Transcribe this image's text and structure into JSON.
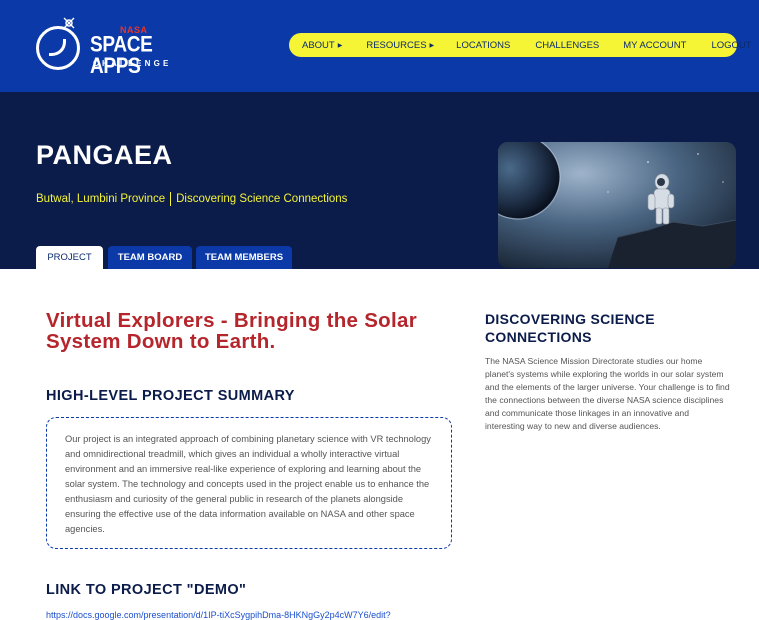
{
  "logo": {
    "nasa": "NASA",
    "title": "SPACE APPS",
    "subtitle": "CHALLENGE"
  },
  "nav": {
    "items": [
      {
        "label": "ABOUT",
        "has_dropdown": true
      },
      {
        "label": "RESOURCES",
        "has_dropdown": true
      },
      {
        "label": "LOCATIONS",
        "has_dropdown": false
      },
      {
        "label": "CHALLENGES",
        "has_dropdown": false
      },
      {
        "label": "MY ACCOUNT",
        "has_dropdown": false
      },
      {
        "label": "LOGOUT",
        "has_dropdown": false
      }
    ],
    "dropdown_icon": "caret-right-icon"
  },
  "hero": {
    "team_name": "PANGAEA",
    "location": "Butwal, Lumbini Province",
    "challenge": "Discovering Science Connections",
    "image": "astronaut-on-cliff-facing-planet"
  },
  "tabs": [
    {
      "label": "PROJECT",
      "active": true
    },
    {
      "label": "TEAM BOARD",
      "active": false
    },
    {
      "label": "TEAM MEMBERS",
      "active": false
    }
  ],
  "project": {
    "title": "Virtual Explorers - Bringing the Solar System Down to Earth.",
    "summary_heading": "HIGH-LEVEL PROJECT SUMMARY",
    "summary": "Our project is an integrated approach of combining planetary science with VR technology and omnidirectional treadmill, which gives an individual a wholly interactive virtual environment and an immersive real-like experience of exploring and learning about the solar system. The technology and concepts used in the project enable us to enhance the enthusiasm and curiosity of the general public in research of the planets alongside ensuring the effective use of the data information available on NASA and other space agencies.",
    "demo_heading": "LINK TO PROJECT \"DEMO\"",
    "demo_link": "https://docs.google.com/presentation/d/1IP-tiXcSygpihDma-8HKNgGy2p4cW7Y6/edit?"
  },
  "sidebar": {
    "heading": "DISCOVERING SCIENCE CONNECTIONS",
    "description": "The NASA Science Mission Directorate studies our home planet's systems while exploring the worlds in our solar system and the elements of the larger universe. Your challenge is to find the connections between the diverse NASA science disciplines and communicate those linkages in an innovative and interesting way to new and diverse audiences."
  },
  "colors": {
    "header_bg": "#0b3aa8",
    "hero_bg": "#0b1b4a",
    "nav_bg": "#f5f536",
    "accent_red": "#b5262c",
    "nasa_red": "#e8332a",
    "tab_blue": "#0b3aa8"
  }
}
